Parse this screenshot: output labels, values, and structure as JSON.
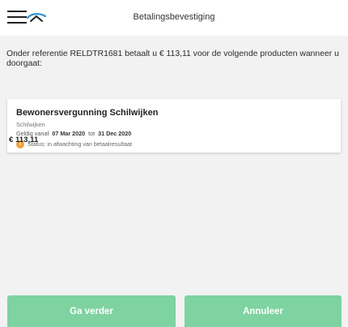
{
  "header": {
    "title": "Betalingsbevestiging",
    "menu_icon": "hamburger-menu-icon",
    "logo_icon": "app-logo-icon",
    "logo_colors": [
      "#2a8fd6",
      "#222222"
    ]
  },
  "intro": {
    "text": "Onder referentie RELDTR1681 betaalt u € 113,11 voor de volgende producten wanneer u doorgaat:"
  },
  "product": {
    "title": "Bewonersvergunning Schilwijken",
    "subtitle": "Schilwijken",
    "valid_from_label": "Geldig vanaf",
    "valid_from": "07 Mar 2020",
    "valid_to_label": "tot",
    "valid_to": "31 Dec 2020",
    "status_icon": "warning-icon",
    "status_icon_glyph": "!",
    "status_color": "#f0a33a",
    "status": "Status: in afwachting van betaalresultaat",
    "price": "€ 113,11"
  },
  "actions": {
    "continue_label": "Ga verder",
    "cancel_label": "Annuleer",
    "button_color": "#7ed3a0"
  }
}
